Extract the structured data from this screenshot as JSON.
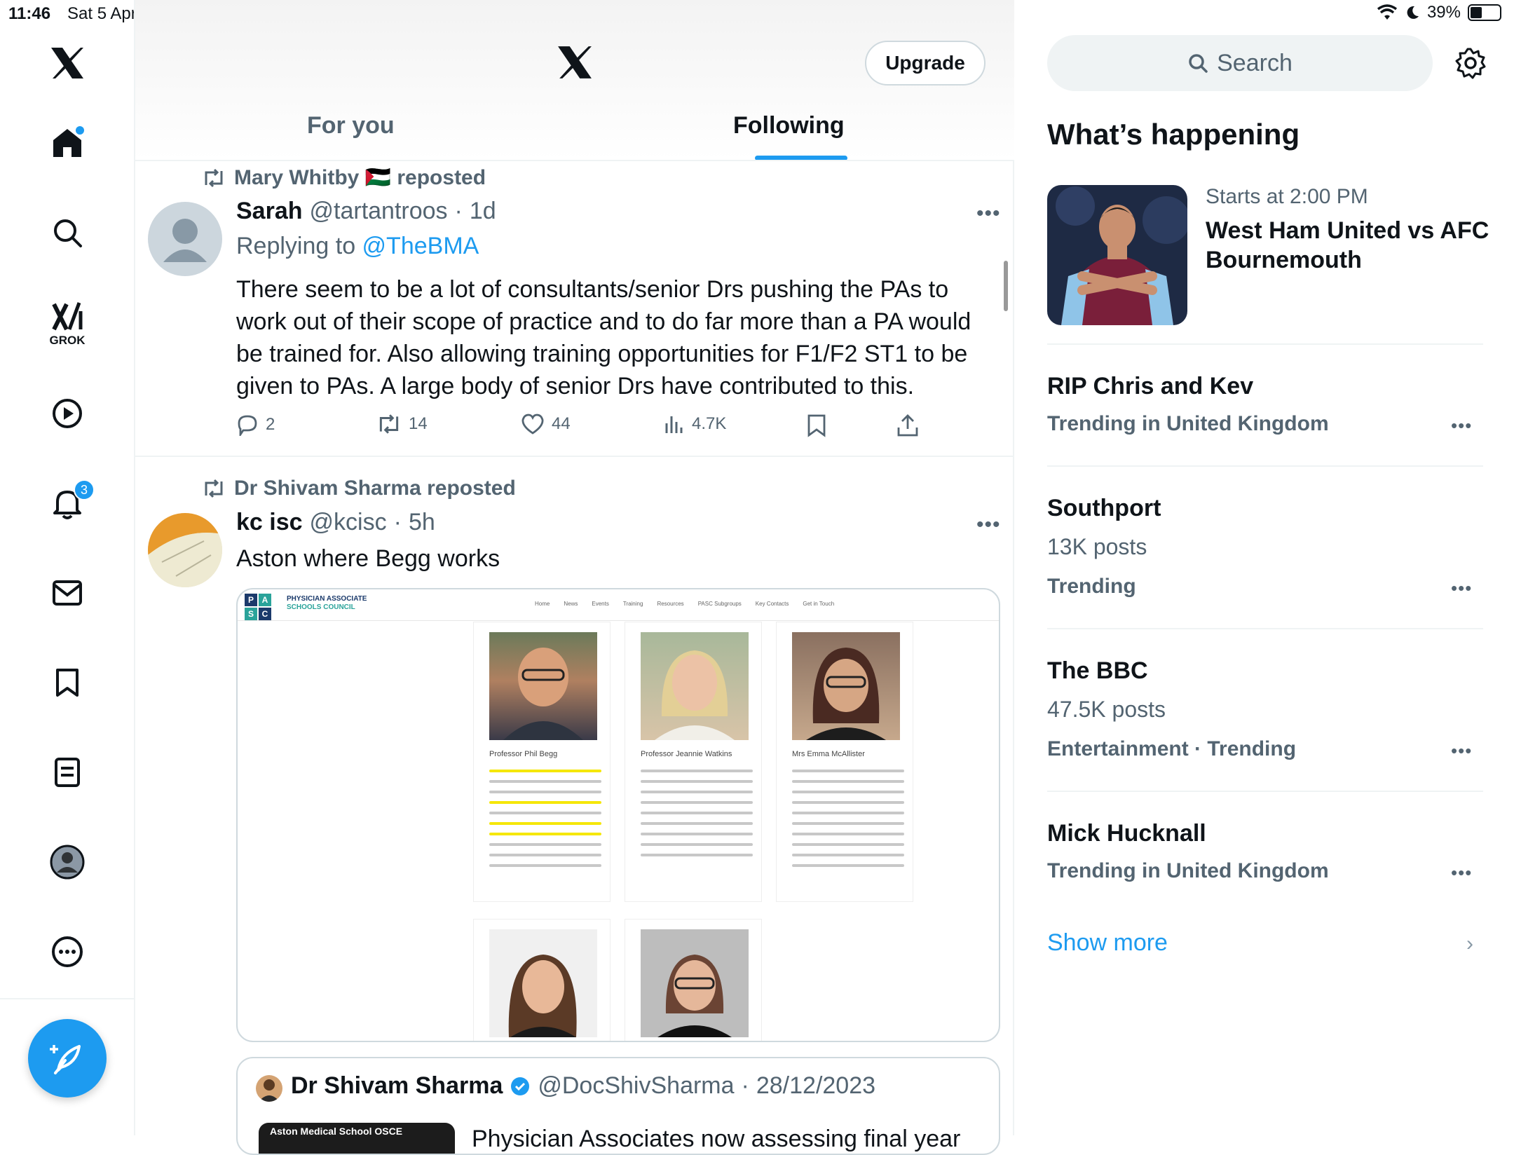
{
  "status_bar": {
    "time": "11:46",
    "date": "Sat 5 Apr",
    "battery": "39%"
  },
  "nav": {
    "grok_label": "GROK",
    "notifications_badge": "3"
  },
  "header": {
    "upgrade_label": "Upgrade",
    "tabs": [
      {
        "label": "For you"
      },
      {
        "label": "Following"
      }
    ]
  },
  "feed": [
    {
      "reposted_by": "Mary Whitby 🇵🇸 reposted",
      "author_name": "Sarah",
      "author_handle": "@tartantroos",
      "time": "1d",
      "replying_prefix": "Replying to ",
      "replying_to": "@TheBMA",
      "text": "There seem to be a lot of consultants/senior Drs pushing the PAs to work out of their scope of practice and to do far more than a PA would be trained for. Also allowing training opportunities for F1/F2 ST1 to be given to PAs. A large body of senior Drs have contributed to this.",
      "replies": "2",
      "reposts": "14",
      "likes": "44",
      "views": "4.7K"
    },
    {
      "reposted_by": "Dr Shivam Sharma reposted",
      "author_name": "kc isc",
      "author_handle": "@kcisc",
      "time": "5h",
      "text": "Aston where Begg  works",
      "media": {
        "logo_letters": [
          "P",
          "A",
          "S",
          "C"
        ],
        "org_line1": "PHYSICIAN ASSOCIATE",
        "org_line2": "SCHOOLS COUNCIL",
        "nav": [
          "Home",
          "News",
          "Events",
          "Training",
          "Resources",
          "PASC Subgroups",
          "Key Contacts",
          "Get in Touch"
        ],
        "people": [
          "Professor Phil Begg",
          "Professor Jeannie Watkins",
          "Mrs Emma McAllister"
        ]
      },
      "quote": {
        "author_name": "Dr Shivam Sharma",
        "author_handle": "@DocShivSharma",
        "date": "28/12/2023",
        "thumb_label": "Aston Medical School OSCE",
        "text": "Physician Associates now assessing final year"
      }
    }
  ],
  "sidebar": {
    "search_placeholder": "Search",
    "whats_happening": "What’s happening",
    "event": {
      "meta": "Starts at 2:00 PM",
      "title": "West Ham United vs AFC Bournemouth"
    },
    "trends": [
      {
        "title": "RIP Chris and Kev",
        "posts": "",
        "context": "Trending in United Kingdom"
      },
      {
        "title": "Southport",
        "posts": "13K posts",
        "context": "Trending"
      },
      {
        "title": "The BBC",
        "posts": "47.5K posts",
        "context": "Entertainment · Trending"
      },
      {
        "title": "Mick Hucknall",
        "posts": "",
        "context": "Trending in United Kingdom"
      }
    ],
    "show_more": "Show more"
  },
  "colors": {
    "accent": "#1d9bf0",
    "text": "#0f1419",
    "secondary": "#536471",
    "border": "#eff3f4"
  }
}
